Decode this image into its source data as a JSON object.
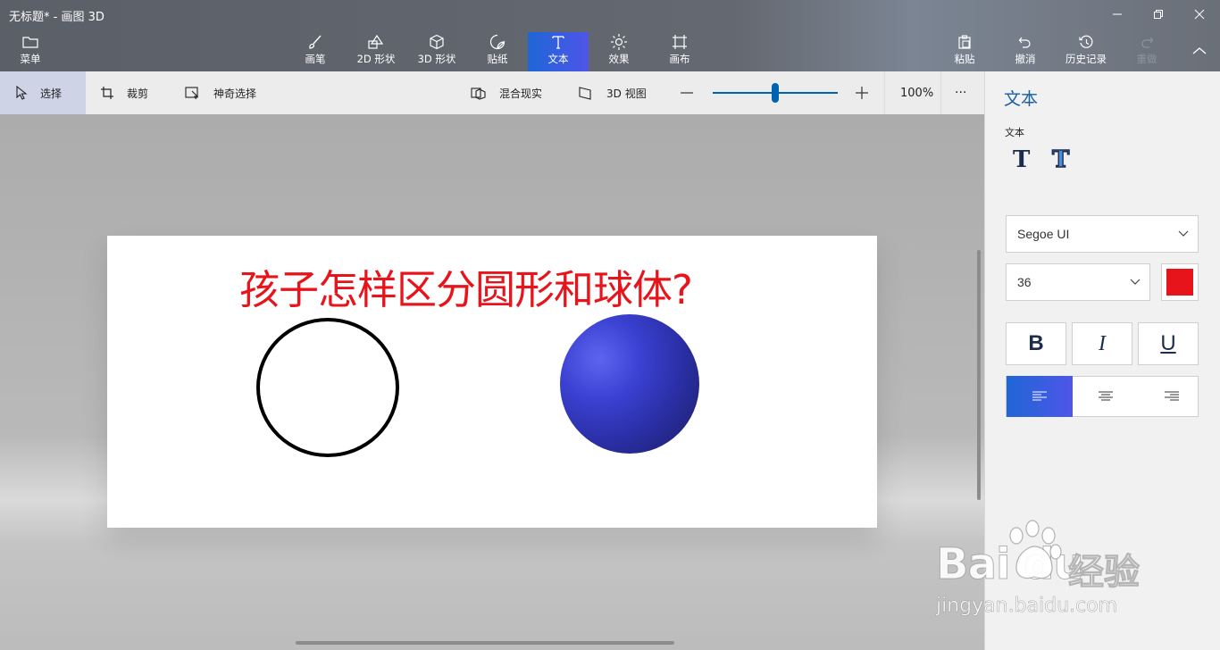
{
  "window": {
    "title": "无标题* - 画图 3D"
  },
  "menu": {
    "label": "菜单",
    "icon": "folder-icon"
  },
  "ribbon": {
    "tools": [
      {
        "label": "画笔",
        "icon": "brush-icon"
      },
      {
        "label": "2D 形状",
        "icon": "shapes-2d-icon"
      },
      {
        "label": "3D 形状",
        "icon": "cube-icon"
      },
      {
        "label": "贴纸",
        "icon": "sticker-icon"
      },
      {
        "label": "文本",
        "icon": "text-icon",
        "active": true
      },
      {
        "label": "效果",
        "icon": "sun-icon"
      },
      {
        "label": "画布",
        "icon": "canvas-icon"
      }
    ],
    "right_tools": [
      {
        "label": "粘贴",
        "icon": "paste-icon"
      },
      {
        "label": "撤消",
        "icon": "undo-icon"
      },
      {
        "label": "历史记录",
        "icon": "history-icon"
      },
      {
        "label": "重做",
        "icon": "redo-icon",
        "disabled": true
      }
    ],
    "accent_color": "#3f5de0"
  },
  "toolbar": {
    "select": "选择",
    "crop": "裁剪",
    "magic_select": "神奇选择",
    "mixed_reality": "混合现实",
    "view_3d": "3D 视图",
    "zoom_value": "100%",
    "zoom_level": 0.47,
    "more": "···"
  },
  "canvas": {
    "headline": "孩子怎样区分圆形和球体?",
    "headline_color": "#e8141b",
    "sphere_color": "#3a40cf"
  },
  "panel": {
    "title": "文本",
    "subtitle": "文本",
    "font_family": "Segoe UI",
    "font_size": "36",
    "text_color": "#e8141b",
    "bold": "B",
    "italic": "I",
    "underline": "U"
  },
  "watermark": {
    "brand_text": "Bai  du",
    "brand_cn": "经验",
    "url": "jingyan.baidu.com"
  }
}
